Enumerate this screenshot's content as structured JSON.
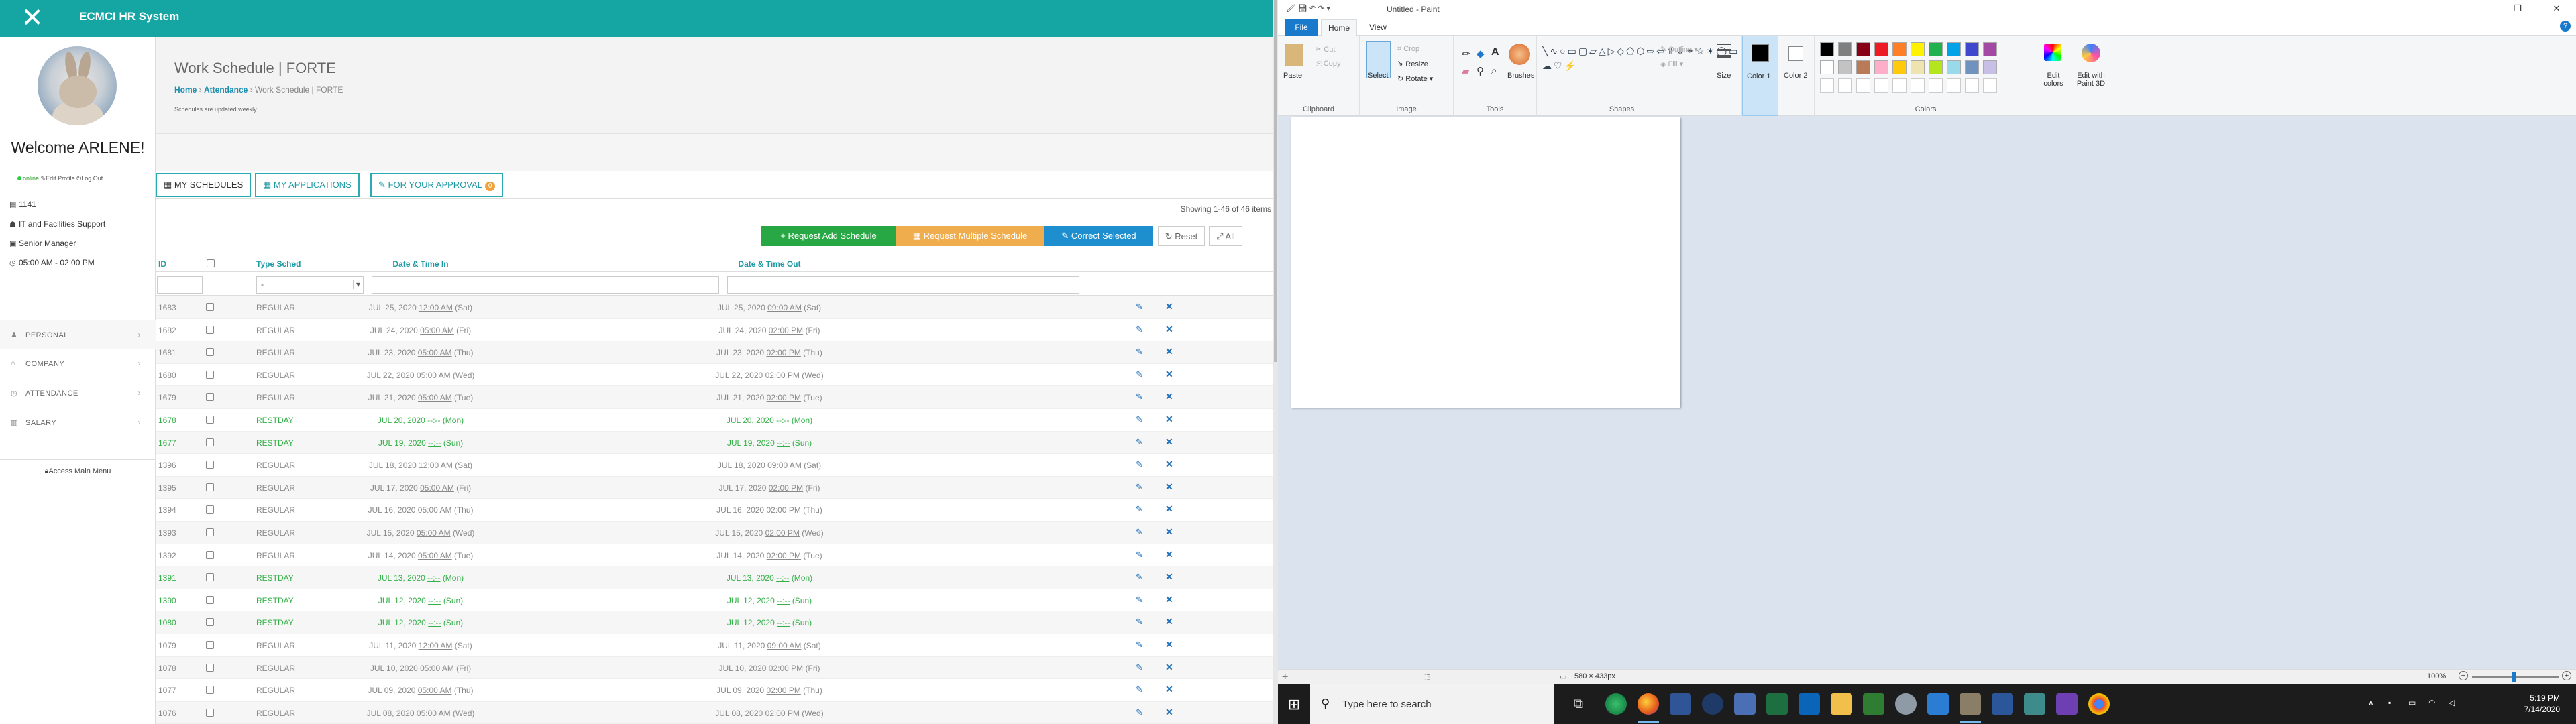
{
  "hr": {
    "app_title": "ECMCI HR System",
    "welcome": "Welcome ARLENE!",
    "status": {
      "online": "online",
      "edit_profile": "Edit Profile",
      "log_out": "Log Out"
    },
    "info": {
      "id": "1141",
      "department": "IT and Facilities Support",
      "position": "Senior Manager",
      "shift": "05:00 AM - 02:00 PM"
    },
    "menu": [
      "PERSONAL",
      "COMPANY",
      "ATTENDANCE",
      "SALARY"
    ],
    "access_main_menu": "Access Main Menu",
    "page_title": "Work Schedule | FORTE",
    "breadcrumb": {
      "home": "Home",
      "attendance": "Attendance",
      "current": "Work Schedule | FORTE"
    },
    "note": "Schedules are updated weekly",
    "tabs": {
      "my_schedules": "MY SCHEDULES",
      "my_applications": "MY APPLICATIONS",
      "for_approval": "FOR YOUR APPROVAL",
      "approval_count": "0"
    },
    "showing": "Showing 1-46 of 46 items",
    "buttons": {
      "add": "Request Add Schedule",
      "multiple": "Request Multiple Schedule",
      "correct": "Correct Selected",
      "reset": "Reset",
      "all": "All"
    },
    "columns": {
      "id": "ID",
      "type": "Type Sched",
      "date_in": "Date & Time In",
      "date_out": "Date & Time Out"
    },
    "filter_type_value": "-",
    "rows": [
      {
        "id": "1683",
        "type": "REGULAR",
        "in_date": "JUL 25, 2020",
        "in_time": "12:00 AM",
        "in_day": "(Sat)",
        "out_date": "JUL 25, 2020",
        "out_time": "09:00 AM",
        "out_day": "(Sat)"
      },
      {
        "id": "1682",
        "type": "REGULAR",
        "in_date": "JUL 24, 2020",
        "in_time": "05:00 AM",
        "in_day": "(Fri)",
        "out_date": "JUL 24, 2020",
        "out_time": "02:00 PM",
        "out_day": "(Fri)"
      },
      {
        "id": "1681",
        "type": "REGULAR",
        "in_date": "JUL 23, 2020",
        "in_time": "05:00 AM",
        "in_day": "(Thu)",
        "out_date": "JUL 23, 2020",
        "out_time": "02:00 PM",
        "out_day": "(Thu)"
      },
      {
        "id": "1680",
        "type": "REGULAR",
        "in_date": "JUL 22, 2020",
        "in_time": "05:00 AM",
        "in_day": "(Wed)",
        "out_date": "JUL 22, 2020",
        "out_time": "02:00 PM",
        "out_day": "(Wed)"
      },
      {
        "id": "1679",
        "type": "REGULAR",
        "in_date": "JUL 21, 2020",
        "in_time": "05:00 AM",
        "in_day": "(Tue)",
        "out_date": "JUL 21, 2020",
        "out_time": "02:00 PM",
        "out_day": "(Tue)"
      },
      {
        "id": "1678",
        "type": "RESTDAY",
        "in_date": "JUL 20, 2020",
        "in_time": "--:--",
        "in_day": "(Mon)",
        "out_date": "JUL 20, 2020",
        "out_time": "--:--",
        "out_day": "(Mon)"
      },
      {
        "id": "1677",
        "type": "RESTDAY",
        "in_date": "JUL 19, 2020",
        "in_time": "--:--",
        "in_day": "(Sun)",
        "out_date": "JUL 19, 2020",
        "out_time": "--:--",
        "out_day": "(Sun)"
      },
      {
        "id": "1396",
        "type": "REGULAR",
        "in_date": "JUL 18, 2020",
        "in_time": "12:00 AM",
        "in_day": "(Sat)",
        "out_date": "JUL 18, 2020",
        "out_time": "09:00 AM",
        "out_day": "(Sat)"
      },
      {
        "id": "1395",
        "type": "REGULAR",
        "in_date": "JUL 17, 2020",
        "in_time": "05:00 AM",
        "in_day": "(Fri)",
        "out_date": "JUL 17, 2020",
        "out_time": "02:00 PM",
        "out_day": "(Fri)"
      },
      {
        "id": "1394",
        "type": "REGULAR",
        "in_date": "JUL 16, 2020",
        "in_time": "05:00 AM",
        "in_day": "(Thu)",
        "out_date": "JUL 16, 2020",
        "out_time": "02:00 PM",
        "out_day": "(Thu)"
      },
      {
        "id": "1393",
        "type": "REGULAR",
        "in_date": "JUL 15, 2020",
        "in_time": "05:00 AM",
        "in_day": "(Wed)",
        "out_date": "JUL 15, 2020",
        "out_time": "02:00 PM",
        "out_day": "(Wed)"
      },
      {
        "id": "1392",
        "type": "REGULAR",
        "in_date": "JUL 14, 2020",
        "in_time": "05:00 AM",
        "in_day": "(Tue)",
        "out_date": "JUL 14, 2020",
        "out_time": "02:00 PM",
        "out_day": "(Tue)"
      },
      {
        "id": "1391",
        "type": "RESTDAY",
        "in_date": "JUL 13, 2020",
        "in_time": "--:--",
        "in_day": "(Mon)",
        "out_date": "JUL 13, 2020",
        "out_time": "--:--",
        "out_day": "(Mon)"
      },
      {
        "id": "1390",
        "type": "RESTDAY",
        "in_date": "JUL 12, 2020",
        "in_time": "--:--",
        "in_day": "(Sun)",
        "out_date": "JUL 12, 2020",
        "out_time": "--:--",
        "out_day": "(Sun)"
      },
      {
        "id": "1080",
        "type": "RESTDAY",
        "in_date": "JUL 12, 2020",
        "in_time": "--:--",
        "in_day": "(Sun)",
        "out_date": "JUL 12, 2020",
        "out_time": "--:--",
        "out_day": "(Sun)"
      },
      {
        "id": "1079",
        "type": "REGULAR",
        "in_date": "JUL 11, 2020",
        "in_time": "12:00 AM",
        "in_day": "(Sat)",
        "out_date": "JUL 11, 2020",
        "out_time": "09:00 AM",
        "out_day": "(Sat)"
      },
      {
        "id": "1078",
        "type": "REGULAR",
        "in_date": "JUL 10, 2020",
        "in_time": "05:00 AM",
        "in_day": "(Fri)",
        "out_date": "JUL 10, 2020",
        "out_time": "02:00 PM",
        "out_day": "(Fri)"
      },
      {
        "id": "1077",
        "type": "REGULAR",
        "in_date": "JUL 09, 2020",
        "in_time": "05:00 AM",
        "in_day": "(Thu)",
        "out_date": "JUL 09, 2020",
        "out_time": "02:00 PM",
        "out_day": "(Thu)"
      },
      {
        "id": "1076",
        "type": "REGULAR",
        "in_date": "JUL 08, 2020",
        "in_time": "05:00 AM",
        "in_day": "(Wed)",
        "out_date": "JUL 08, 2020",
        "out_time": "02:00 PM",
        "out_day": "(Wed)"
      }
    ],
    "colors": {
      "topbar": "#15a6a3",
      "restday": "#34b048",
      "add": "#27a844",
      "multiple": "#f0ad4e",
      "correct": "#1d8fce"
    }
  },
  "paint": {
    "window_title": "Untitled - Paint",
    "tabs": {
      "file": "File",
      "home": "Home",
      "view": "View"
    },
    "clipboard": {
      "paste": "Paste",
      "cut": "Cut",
      "copy": "Copy",
      "label": "Clipboard"
    },
    "image": {
      "select": "Select",
      "crop": "Crop",
      "resize": "Resize",
      "rotate": "Rotate",
      "label": "Image"
    },
    "tools": {
      "label": "Tools",
      "brushes": "Brushes"
    },
    "shapes": {
      "outline": "Outline",
      "fill": "Fill",
      "label": "Shapes"
    },
    "size": "Size",
    "color1": "Color 1",
    "color2": "Color 2",
    "colors_label": "Colors",
    "edit_colors": "Edit colors",
    "edit_paint3d": "Edit with Paint 3D",
    "palette_row1": [
      "#000000",
      "#7f7f7f",
      "#880015",
      "#ed1c24",
      "#ff7f27",
      "#fff200",
      "#22b14c",
      "#00a2e8",
      "#3f48cc",
      "#a349a4"
    ],
    "palette_row2": [
      "#ffffff",
      "#c3c3c3",
      "#b97a57",
      "#ffaec9",
      "#ffc90e",
      "#efe4b0",
      "#b5e61d",
      "#99d9ea",
      "#7092be",
      "#c8bfe7"
    ],
    "canvas_size": "580 × 433px",
    "zoom": "100%"
  },
  "taskbar": {
    "search_placeholder": "Type here to search",
    "time": "5:19 PM",
    "date": "7/14/2020"
  }
}
